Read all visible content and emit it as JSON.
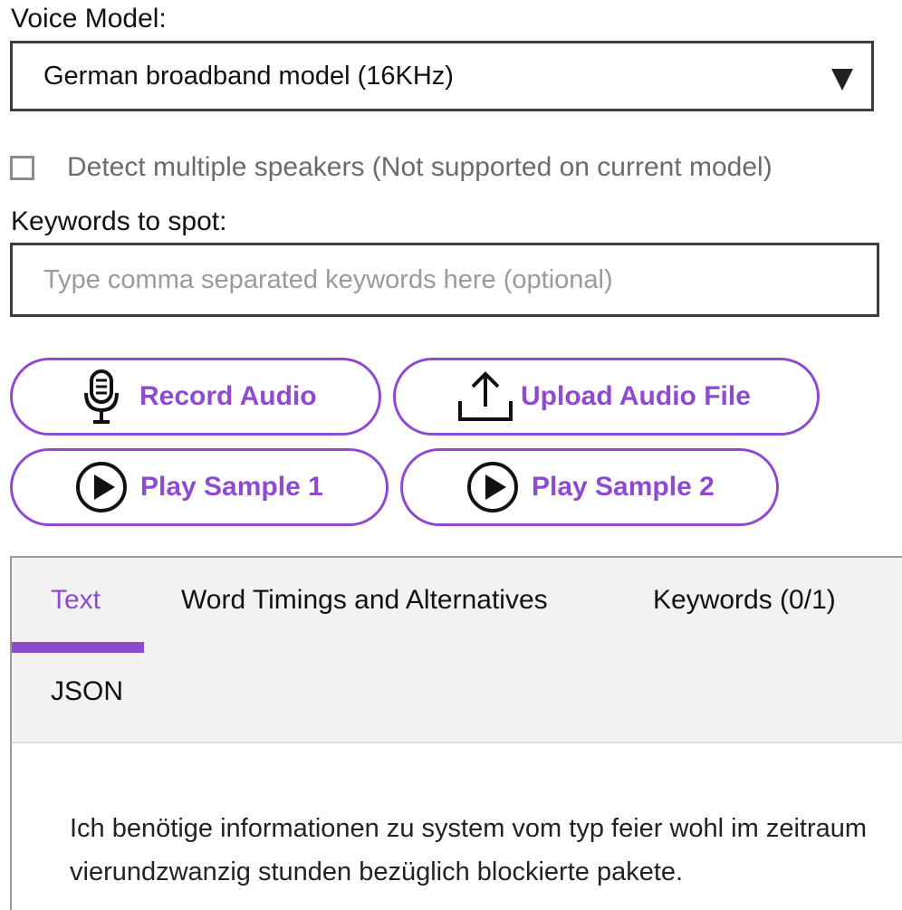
{
  "voice_model": {
    "label": "Voice Model:",
    "selected": "German broadband model (16KHz)"
  },
  "speakers": {
    "label": "Detect multiple speakers (Not supported on current model)",
    "checked": false
  },
  "keywords": {
    "label": "Keywords to spot:",
    "value": "",
    "placeholder": "Type comma separated keywords here (optional)"
  },
  "buttons": {
    "record": "Record Audio",
    "upload": "Upload Audio File",
    "sample1": "Play Sample 1",
    "sample2": "Play Sample 2"
  },
  "icons": {
    "record": "microphone-icon",
    "upload": "upload-icon",
    "sample": "play-circle-icon",
    "dropdown": "triangle-down-icon"
  },
  "tabs": [
    {
      "label": "Text",
      "active": true
    },
    {
      "label": "Word Timings and Alternatives",
      "active": false
    },
    {
      "label": "Keywords (0/1)",
      "active": false
    },
    {
      "label": "JSON",
      "active": false
    }
  ],
  "transcript": "Ich benötige informationen zu system vom typ feier wohl im zeitraum vierundzwanzig stunden bezüglich blockierte pakete.",
  "colors": {
    "accent": "#8f4bcf",
    "border": "#3d3d3d",
    "tab_bar_bg": "#f2f2f2",
    "muted_text": "#6b6b6b"
  }
}
